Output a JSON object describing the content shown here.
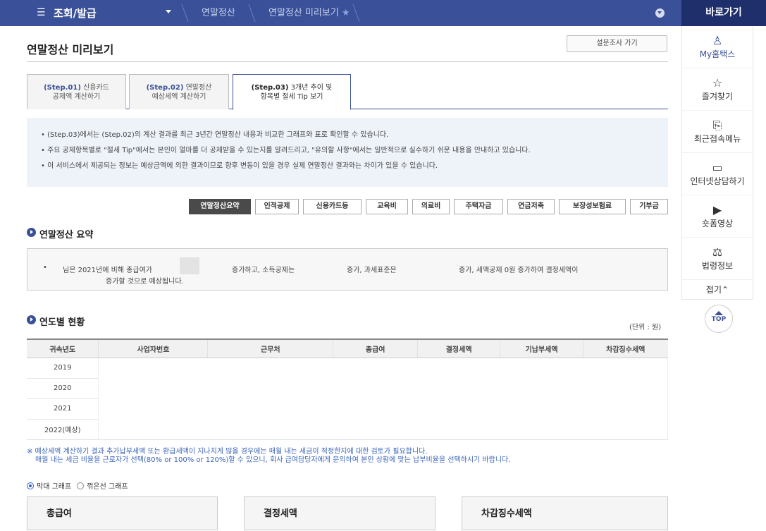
{
  "topbar": {
    "menu_title": "조회/발급",
    "crumbs": [
      "연말정산",
      "연말정산 미리보기"
    ]
  },
  "side": {
    "title": "바로가기",
    "items": [
      {
        "label": "My홈택스",
        "icon": "person-icon"
      },
      {
        "label": "즐겨찾기",
        "icon": "star-icon"
      },
      {
        "label": "최근접속메뉴",
        "icon": "recent-icon"
      },
      {
        "label": "인터넷상담하기",
        "icon": "monitor-icon"
      },
      {
        "label": "숏폼영상",
        "icon": "play-icon"
      },
      {
        "label": "법령정보",
        "icon": "gavel-icon"
      }
    ],
    "fold": "접기⌃",
    "top": "TOP"
  },
  "page": {
    "title": "연말정산 미리보기",
    "survey_button": "설문조사 가기"
  },
  "tabs": [
    {
      "step": "(Step.01)",
      "line1": "신용카드",
      "line2": "공제액 계산하기"
    },
    {
      "step": "(Step.02)",
      "line1": "연말정산",
      "line2": "예상세액 계산하기"
    },
    {
      "step": "(Step.03)",
      "line1": "3개년 추이 및",
      "line2": "항목별 절세 Tip 보기"
    }
  ],
  "info": [
    "• (Step.03)에서는 (Step.02)의 계산 결과를 최근 3년간 연말정산 내용과 비교한 그래프와 표로 확인할 수 있습니다.",
    "• 주요 공제항목별로 \"절세 Tip\"에서는 본인이 얼마를 더 공제받을 수 있는지를 알려드리고, \"유의할 사항\"에서는 일반적으로 실수하기 쉬운 내용을 안내하고 있습니다.",
    "• 이 서비스에서 제공되는 정보는 예상금액에 의한 결과이므로 향후 변동이 있을 경우 실제 연말정산 결과와는 차이가 있을 수 있습니다."
  ],
  "buttons": [
    "연말정산요약",
    "인적공제",
    "신용카드등",
    "교육비",
    "의료비",
    "주택자금",
    "연금저축",
    "보장성보험료",
    "기부금"
  ],
  "summary": {
    "title": "연말정산 요약",
    "bullet": "•",
    "s1": "님은 2021년에 비해 총급여가",
    "s2": "증가하고, 소득공제는",
    "s3": "증가, 과세표준은",
    "s4": "증가, 세액공제 0원 증가하여 결정세액이",
    "s5": "증가할 것으로 예상됩니다."
  },
  "yearly": {
    "title": "연도별 현황",
    "unit": "(단위 : 원)",
    "headers": [
      "귀속년도",
      "사업자번호",
      "근무처",
      "총급여",
      "결정세액",
      "기납부세액",
      "차감징수세액"
    ],
    "years": [
      "2019",
      "2020",
      "2021",
      "2022(예상)"
    ]
  },
  "note": {
    "line1": "※ 예상세액 계산하기 결과 추가납부세액 또는 환급세액이 지나치게 많을 경우에는 매월 내는 세금이 적정한지에 대한 검토가 필요합니다.",
    "line2": "매월 내는 세금 비율을 근로자가 선택(80% or 100% or 120%)할 수 있으니, 회사 급여담당자에게 문의하여 본인 상황에 맞는 납부비율을 선택하시기 바랍니다."
  },
  "graph": {
    "bar_label": "막대 그래프",
    "line_label": "꺾은선 그래프"
  },
  "cards": [
    "총급여",
    "결정세액",
    "차감징수세액"
  ]
}
